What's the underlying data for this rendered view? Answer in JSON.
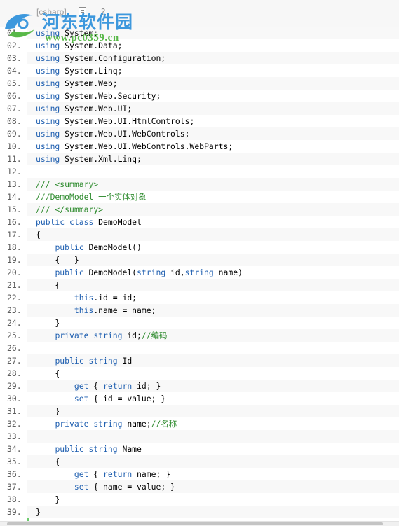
{
  "toolbar": {
    "language": "[csharp]"
  },
  "watermark": {
    "site_name": "河东软件园",
    "site_url": "www.pc0359.cn"
  },
  "colors": {
    "keyword": "#1f5fb0",
    "comment": "#2e8b2e",
    "gutter_bar": "#6ccb6c",
    "text": "#000000"
  },
  "lines": [
    {
      "num": "01.",
      "parts": [
        {
          "t": "using",
          "k": "kw"
        },
        {
          "t": " System;"
        }
      ]
    },
    {
      "num": "02.",
      "parts": [
        {
          "t": "using",
          "k": "kw"
        },
        {
          "t": " System.Data;"
        }
      ]
    },
    {
      "num": "03.",
      "parts": [
        {
          "t": "using",
          "k": "kw"
        },
        {
          "t": " System.Configuration;"
        }
      ]
    },
    {
      "num": "04.",
      "parts": [
        {
          "t": "using",
          "k": "kw"
        },
        {
          "t": " System.Linq;"
        }
      ]
    },
    {
      "num": "05.",
      "parts": [
        {
          "t": "using",
          "k": "kw"
        },
        {
          "t": " System.Web;"
        }
      ]
    },
    {
      "num": "06.",
      "parts": [
        {
          "t": "using",
          "k": "kw"
        },
        {
          "t": " System.Web.Security;"
        }
      ]
    },
    {
      "num": "07.",
      "parts": [
        {
          "t": "using",
          "k": "kw"
        },
        {
          "t": " System.Web.UI;"
        }
      ]
    },
    {
      "num": "08.",
      "parts": [
        {
          "t": "using",
          "k": "kw"
        },
        {
          "t": " System.Web.UI.HtmlControls;"
        }
      ]
    },
    {
      "num": "09.",
      "parts": [
        {
          "t": "using",
          "k": "kw"
        },
        {
          "t": " System.Web.UI.WebControls;"
        }
      ]
    },
    {
      "num": "10.",
      "parts": [
        {
          "t": "using",
          "k": "kw"
        },
        {
          "t": " System.Web.UI.WebControls.WebParts;"
        }
      ]
    },
    {
      "num": "11.",
      "parts": [
        {
          "t": "using",
          "k": "kw"
        },
        {
          "t": " System.Xml.Linq;"
        }
      ]
    },
    {
      "num": "12.",
      "parts": []
    },
    {
      "num": "13.",
      "parts": [
        {
          "t": "/// <summary>",
          "k": "cm"
        }
      ]
    },
    {
      "num": "14.",
      "parts": [
        {
          "t": "///DemoModel 一个实体对象",
          "k": "cm"
        }
      ]
    },
    {
      "num": "15.",
      "parts": [
        {
          "t": "/// </summary>",
          "k": "cm"
        }
      ]
    },
    {
      "num": "16.",
      "parts": [
        {
          "t": "public",
          "k": "kw"
        },
        {
          "t": " "
        },
        {
          "t": "class",
          "k": "kw"
        },
        {
          "t": " DemoModel"
        }
      ]
    },
    {
      "num": "17.",
      "parts": [
        {
          "t": "{"
        }
      ]
    },
    {
      "num": "18.",
      "parts": [
        {
          "t": "    "
        },
        {
          "t": "public",
          "k": "kw"
        },
        {
          "t": " DemoModel()"
        }
      ]
    },
    {
      "num": "19.",
      "parts": [
        {
          "t": "    {   }"
        }
      ]
    },
    {
      "num": "20.",
      "parts": [
        {
          "t": "    "
        },
        {
          "t": "public",
          "k": "kw"
        },
        {
          "t": " DemoModel("
        },
        {
          "t": "string",
          "k": "kw"
        },
        {
          "t": " id,"
        },
        {
          "t": "string",
          "k": "kw"
        },
        {
          "t": " name)"
        }
      ]
    },
    {
      "num": "21.",
      "parts": [
        {
          "t": "    {"
        }
      ]
    },
    {
      "num": "22.",
      "parts": [
        {
          "t": "        "
        },
        {
          "t": "this",
          "k": "kw"
        },
        {
          "t": ".id = id;"
        }
      ]
    },
    {
      "num": "23.",
      "parts": [
        {
          "t": "        "
        },
        {
          "t": "this",
          "k": "kw"
        },
        {
          "t": ".name = name;"
        }
      ]
    },
    {
      "num": "24.",
      "parts": [
        {
          "t": "    }"
        }
      ]
    },
    {
      "num": "25.",
      "parts": [
        {
          "t": "    "
        },
        {
          "t": "private",
          "k": "kw"
        },
        {
          "t": " "
        },
        {
          "t": "string",
          "k": "kw"
        },
        {
          "t": " id;"
        },
        {
          "t": "//编码",
          "k": "cm"
        }
      ]
    },
    {
      "num": "26.",
      "parts": []
    },
    {
      "num": "27.",
      "parts": [
        {
          "t": "    "
        },
        {
          "t": "public",
          "k": "kw"
        },
        {
          "t": " "
        },
        {
          "t": "string",
          "k": "kw"
        },
        {
          "t": " Id"
        }
      ]
    },
    {
      "num": "28.",
      "parts": [
        {
          "t": "    {"
        }
      ]
    },
    {
      "num": "29.",
      "parts": [
        {
          "t": "        "
        },
        {
          "t": "get",
          "k": "kw"
        },
        {
          "t": " { "
        },
        {
          "t": "return",
          "k": "kw"
        },
        {
          "t": " id; }"
        }
      ]
    },
    {
      "num": "30.",
      "parts": [
        {
          "t": "        "
        },
        {
          "t": "set",
          "k": "kw"
        },
        {
          "t": " { id = value; }"
        }
      ]
    },
    {
      "num": "31.",
      "parts": [
        {
          "t": "    }"
        }
      ]
    },
    {
      "num": "32.",
      "parts": [
        {
          "t": "    "
        },
        {
          "t": "private",
          "k": "kw"
        },
        {
          "t": " "
        },
        {
          "t": "string",
          "k": "kw"
        },
        {
          "t": " name;"
        },
        {
          "t": "//名称",
          "k": "cm"
        }
      ]
    },
    {
      "num": "33.",
      "parts": []
    },
    {
      "num": "34.",
      "parts": [
        {
          "t": "    "
        },
        {
          "t": "public",
          "k": "kw"
        },
        {
          "t": " "
        },
        {
          "t": "string",
          "k": "kw"
        },
        {
          "t": " Name"
        }
      ]
    },
    {
      "num": "35.",
      "parts": [
        {
          "t": "    {"
        }
      ]
    },
    {
      "num": "36.",
      "parts": [
        {
          "t": "        "
        },
        {
          "t": "get",
          "k": "kw"
        },
        {
          "t": " { "
        },
        {
          "t": "return",
          "k": "kw"
        },
        {
          "t": " name; }"
        }
      ]
    },
    {
      "num": "37.",
      "parts": [
        {
          "t": "        "
        },
        {
          "t": "set",
          "k": "kw"
        },
        {
          "t": " { name = value; }"
        }
      ]
    },
    {
      "num": "38.",
      "parts": [
        {
          "t": "    }"
        }
      ]
    },
    {
      "num": "39.",
      "parts": [
        {
          "t": "}"
        }
      ]
    }
  ]
}
